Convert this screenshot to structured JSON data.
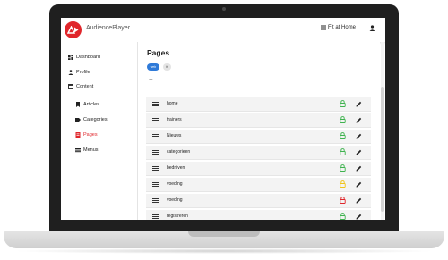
{
  "app": {
    "brand": "AudiencePlayer",
    "fit_home": "Fit at Home",
    "accent": "#e0262b"
  },
  "sidebar": {
    "items": [
      {
        "label": "Dashboard",
        "icon": "dashboard-icon"
      },
      {
        "label": "Profile",
        "icon": "person-icon"
      },
      {
        "label": "Content",
        "icon": "content-icon"
      }
    ],
    "subitems": [
      {
        "label": "Articles",
        "icon": "bookmark-icon",
        "active": false
      },
      {
        "label": "Categories",
        "icon": "label-icon",
        "active": false
      },
      {
        "label": "Pages",
        "icon": "page-icon",
        "active": true
      },
      {
        "label": "Menus",
        "icon": "menu-icon",
        "active": false
      }
    ]
  },
  "main": {
    "title": "Pages",
    "languages": [
      {
        "label": "web",
        "selected": true
      },
      {
        "label": "fr",
        "selected": false
      }
    ],
    "add_label": "+",
    "rows": [
      {
        "label": "home",
        "lock_color": "#3fb34f"
      },
      {
        "label": "trainers",
        "lock_color": "#3fb34f"
      },
      {
        "label": "Nieuws",
        "lock_color": "#3fb34f"
      },
      {
        "label": "categorieen",
        "lock_color": "#3fb34f"
      },
      {
        "label": "bedrijven",
        "lock_color": "#3fb34f"
      },
      {
        "label": "voeding",
        "lock_color": "#f0c419"
      },
      {
        "label": "voeding",
        "lock_color": "#e0262b"
      },
      {
        "label": "registreren",
        "lock_color": "#3fb34f"
      }
    ]
  }
}
